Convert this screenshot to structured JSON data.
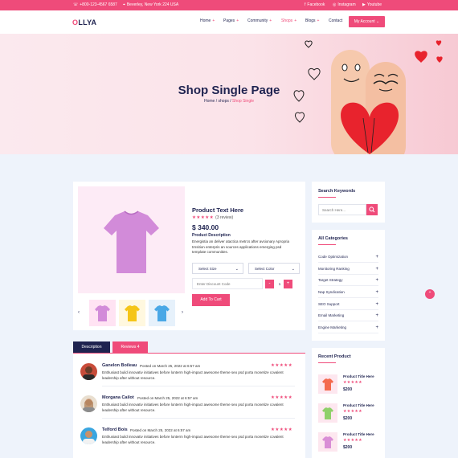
{
  "topbar": {
    "phone": "+800-123-4567 6587",
    "address": "Beverley, New York 224 USA",
    "facebook": "Facebook",
    "instagram": "Instagram",
    "youtube": "Youtube"
  },
  "header": {
    "logo": "LLYA",
    "logo_first": "O",
    "nav": [
      {
        "label": "Home",
        "plus": "+"
      },
      {
        "label": "Pages",
        "plus": "+"
      },
      {
        "label": "Community",
        "plus": "+"
      },
      {
        "label": "Shops",
        "plus": "+"
      },
      {
        "label": "Blogs",
        "plus": "+"
      },
      {
        "label": "Contact",
        "plus": ""
      }
    ],
    "account_button": "My Account",
    "account_chevron": "⌄"
  },
  "banner": {
    "title": "Shop Single Page",
    "crumbs": [
      "Home",
      "shops",
      "Shop Single"
    ],
    "sep": "/"
  },
  "product": {
    "title": "Product Text Here",
    "stars": "★★★★★",
    "reviews_count": "(3 review)",
    "price": "$ 340.00",
    "desc_title": "Product Description",
    "description": "Energistia an deliver atactica metrcs after avsionary Apropria trnsition enterpris an sources applications emerging psd template communities.",
    "size_select": "Select Size",
    "color_select": "Select Color",
    "chevron": "⌄",
    "discount_placeholder": "Enter Discount Code",
    "qty_minus": "-",
    "qty_value": "1",
    "qty_plus": "+",
    "cart_button": "Add To Cart",
    "prev_arrow": "‹",
    "next_arrow": "›",
    "thumbnail_colors": [
      "#ffe3f3",
      "#fff8df",
      "#e6f1fb"
    ]
  },
  "tabs": {
    "description": "Description",
    "reviews": "Reviews 4"
  },
  "reviews": [
    {
      "name": "Ganelon Boileau",
      "date": "Posted on March 25, 2022 at 6:57 am",
      "stars": "★★★★★",
      "text": "Enthusiast build innovativ initiatives before lonterm high-impact awesome theme seo psd porta monetize covalent leadership after without resource."
    },
    {
      "name": "Morgana Cailot",
      "date": "Posted on March 25, 2022 at 6:57 am",
      "stars": "★★★★★",
      "text": "Enthusiast build innovativ initiatives before lonterm high-impact awesome theme seo psd porta monetize covalent leadership after without resource."
    },
    {
      "name": "Telford Bois",
      "date": "Posted on March 25, 2022 at 6:57 am",
      "stars": "★★★★★",
      "text": "Enthusiast build innovativ initiatives before lonterm high-impact awesome theme seo psd porta monetize covalent leadership after without resource."
    }
  ],
  "sidebar": {
    "search": {
      "title": "Search Keywords",
      "placeholder": "Search Here..."
    },
    "categories": {
      "title": "All Categories",
      "plus": "+",
      "items": [
        "Code Optimization",
        "Monitoring Ranking",
        "Target Strategy",
        "Nap Syndication",
        "SEO Support",
        "Email Marketing",
        "Engine Marketing"
      ]
    },
    "recent": {
      "title": "Recent Product",
      "items": [
        {
          "title": "Product Title Here",
          "stars": "★★★★★",
          "price": "$200",
          "color": "#f46a4e"
        },
        {
          "title": "Product Title Here",
          "stars": "★★★★★",
          "price": "$200",
          "color": "#8fd06a"
        },
        {
          "title": "Product Title Here",
          "stars": "★★★★★",
          "price": "$200",
          "color": "#d98ed6"
        }
      ]
    }
  },
  "scroll_up": "⌃",
  "colors": {
    "accent": "#ef4b7a",
    "navy": "#1f2350",
    "background": "#eef3fb"
  }
}
